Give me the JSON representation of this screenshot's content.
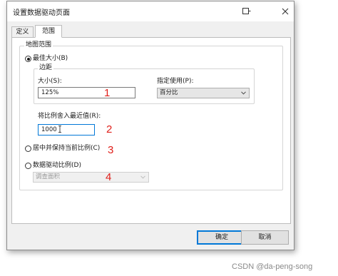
{
  "window": {
    "title": "设置数据驱动页面"
  },
  "tabs": [
    {
      "label": "定义",
      "active": false
    },
    {
      "label": "范围",
      "active": true
    }
  ],
  "map_extent": {
    "group_title": "地图范围",
    "best_fit": {
      "label": "最佳大小(B)",
      "selected": true,
      "margin": {
        "group_title": "边距",
        "size_label": "大小(S):",
        "size_value": "125%",
        "units_label": "指定使用(P):",
        "units_value": "百分比"
      },
      "round_label": "将比例舍入最近值(R):",
      "round_value": "1000"
    },
    "center_option": {
      "label": "居中并保持当前比例(C)",
      "selected": false
    },
    "data_driven_option": {
      "label": "数据驱动比例(D)",
      "selected": false,
      "field_value": "调查面积"
    }
  },
  "annotations": [
    "1",
    "2",
    "3",
    "4"
  ],
  "buttons": {
    "ok": "确定",
    "cancel": "取消"
  },
  "watermark": "CSDN @da-peng-song",
  "colors": {
    "annotation": "#e0201b",
    "focus_border": "#0078d7",
    "dialog_bg": "#f0f0f0"
  }
}
